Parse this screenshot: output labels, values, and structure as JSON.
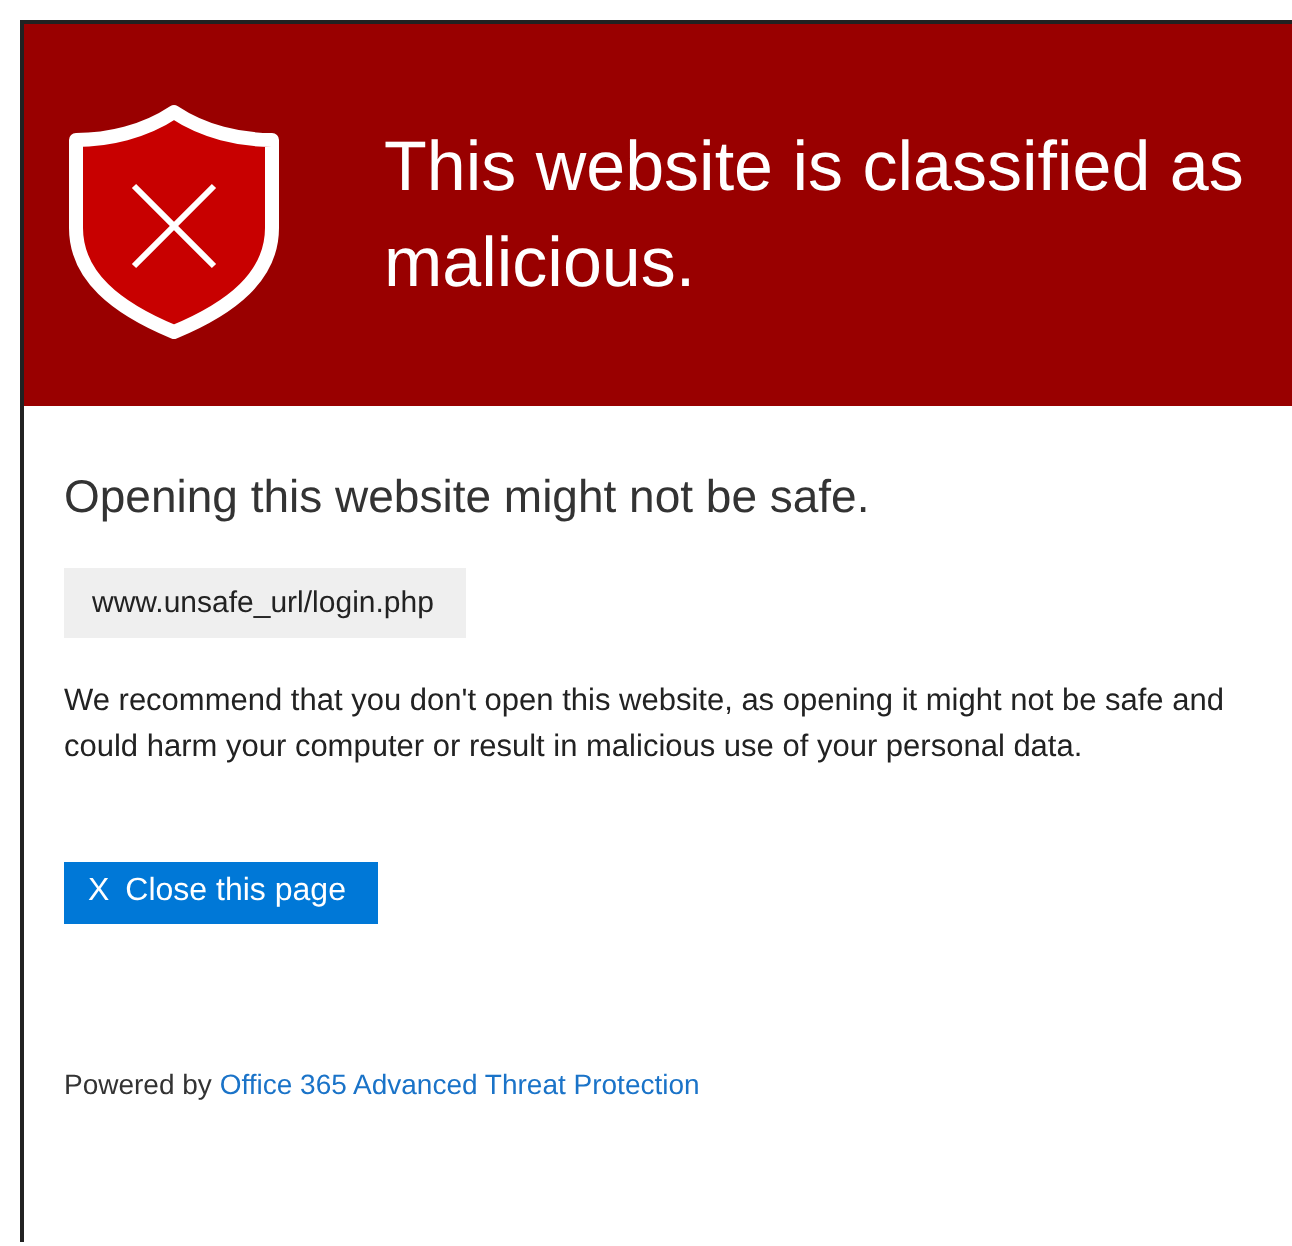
{
  "header": {
    "title": "This website is classified as malicious."
  },
  "heading": "Opening this website might not be safe.",
  "url": "www.unsafe_url/login.php",
  "message": "We recommend that you don't open this website, as opening it might not be safe and could harm your computer or result in malicious use of your personal data.",
  "close_button": {
    "icon": "X",
    "label": "Close this page"
  },
  "footer": {
    "prefix": "Powered by",
    "link": "Office 365 Advanced Threat Protection"
  }
}
